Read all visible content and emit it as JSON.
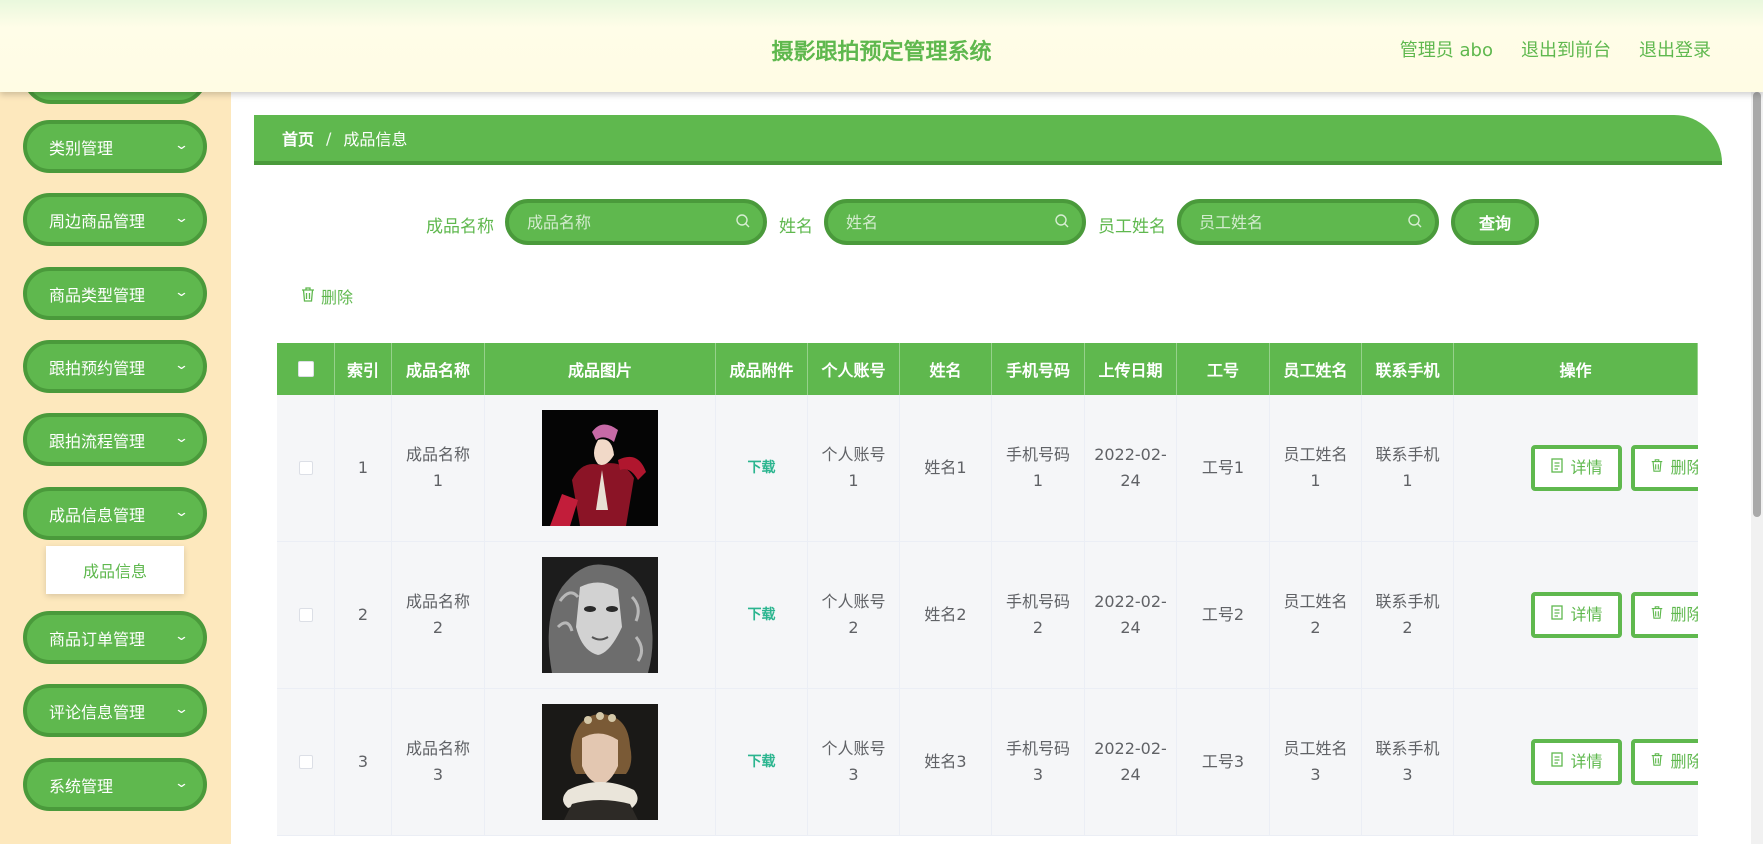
{
  "header": {
    "title": "摄影跟拍预定管理系统",
    "user_label": "管理员 abo",
    "front_link": "退出到前台",
    "logout_link": "退出登录"
  },
  "sidebar": {
    "items": [
      {
        "label": "类别管理"
      },
      {
        "label": "周边商品管理"
      },
      {
        "label": "商品类型管理"
      },
      {
        "label": "跟拍预约管理"
      },
      {
        "label": "跟拍流程管理"
      },
      {
        "label": "成品信息管理"
      },
      {
        "label": "商品订单管理"
      },
      {
        "label": "评论信息管理"
      },
      {
        "label": "系统管理"
      }
    ],
    "active_submenu": "成品信息"
  },
  "breadcrumb": {
    "home": "首页",
    "separator": "/",
    "current": "成品信息"
  },
  "search": {
    "product_name_label": "成品名称",
    "product_name_placeholder": "成品名称",
    "name_label": "姓名",
    "name_placeholder": "姓名",
    "employee_name_label": "员工姓名",
    "employee_name_placeholder": "员工姓名",
    "query_button": "查询"
  },
  "actions": {
    "delete_label": "删除"
  },
  "table": {
    "headers": [
      "索引",
      "成品名称",
      "成品图片",
      "成品附件",
      "个人账号",
      "姓名",
      "手机号码",
      "上传日期",
      "工号",
      "员工姓名",
      "联系手机",
      "操作"
    ],
    "rows": [
      {
        "index": "1",
        "name": [
          "成品名称",
          "1"
        ],
        "attachment": "下载",
        "account": [
          "个人账号",
          "1"
        ],
        "person": "姓名1",
        "phone": [
          "手机号码",
          "1"
        ],
        "date": [
          "2022-02-",
          "24"
        ],
        "emp_no": "工号1",
        "emp_name": [
          "员工姓名",
          "1"
        ],
        "contact": [
          "联系手机",
          "1"
        ],
        "detail": "详情",
        "delete": "删除"
      },
      {
        "index": "2",
        "name": [
          "成品名称",
          "2"
        ],
        "attachment": "下载",
        "account": [
          "个人账号",
          "2"
        ],
        "person": "姓名2",
        "phone": [
          "手机号码",
          "2"
        ],
        "date": [
          "2022-02-",
          "24"
        ],
        "emp_no": "工号2",
        "emp_name": [
          "员工姓名",
          "2"
        ],
        "contact": [
          "联系手机",
          "2"
        ],
        "detail": "详情",
        "delete": "删除"
      },
      {
        "index": "3",
        "name": [
          "成品名称",
          "3"
        ],
        "attachment": "下载",
        "account": [
          "个人账号",
          "3"
        ],
        "person": "姓名3",
        "phone": [
          "手机号码",
          "3"
        ],
        "date": [
          "2022-02-",
          "24"
        ],
        "emp_no": "工号3",
        "emp_name": [
          "员工姓名",
          "3"
        ],
        "contact": [
          "联系手机",
          "3"
        ],
        "detail": "详情",
        "delete": "删除"
      }
    ]
  },
  "colors": {
    "primary": "#5fb84e",
    "primary_dark": "#4a9a3b",
    "sidebar_bg": "#fde8bd",
    "header_bg": "#fffce4",
    "download": "#2bb58f"
  },
  "icons": {
    "menu_chevron": "chevron-down-icon",
    "search": "search-icon",
    "delete": "trash-icon",
    "detail": "document-icon"
  }
}
